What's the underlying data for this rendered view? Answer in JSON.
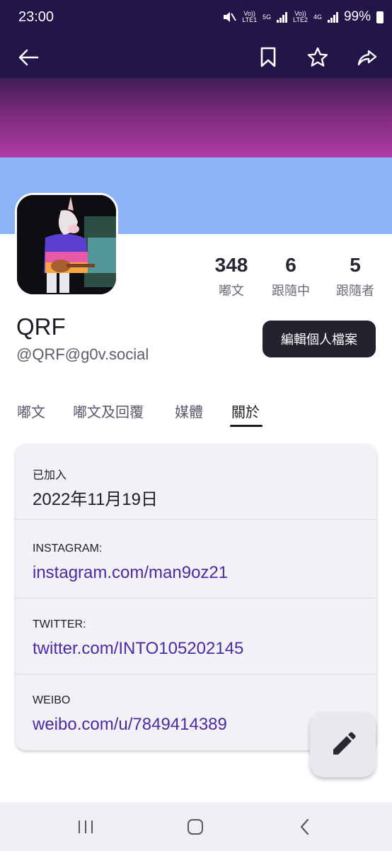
{
  "status_bar": {
    "time": "23:00",
    "sim1_label": "LTE1",
    "sim1_volte": "Vo))",
    "net1": "5G",
    "sim2_label": "LTE2",
    "sim2_volte": "Vo))",
    "net2": "4G",
    "battery": "99%",
    "icons": [
      "mute-icon",
      "signal-icon",
      "battery-icon"
    ]
  },
  "app_bar": {
    "icons": [
      "back-arrow-icon",
      "bookmark-icon",
      "star-icon",
      "share-icon"
    ]
  },
  "profile": {
    "display_name": "QRF",
    "handle": "@QRF@g0v.social",
    "edit_button": "編輯個人檔案",
    "stats": [
      {
        "value": "348",
        "label": "嘟文"
      },
      {
        "value": "6",
        "label": "跟隨中"
      },
      {
        "value": "5",
        "label": "跟隨者"
      }
    ]
  },
  "tabs": [
    {
      "label": "嘟文"
    },
    {
      "label": "嘟文及回覆"
    },
    {
      "label": "媒體"
    },
    {
      "label": "關於"
    }
  ],
  "active_tab": "關於",
  "about": {
    "fields": [
      {
        "label": "已加入",
        "value": "2022年11月19日"
      },
      {
        "label": "INSTAGRAM:",
        "value": "instagram.com/man9oz21"
      },
      {
        "label": "TWITTER:",
        "value": "twitter.com/INTO105202145"
      },
      {
        "label": "WEIBO",
        "value": "weibo.com/u/7849414389"
      }
    ]
  },
  "fab": {
    "icon": "pencil-icon"
  },
  "colors": {
    "app_bar": "#211647",
    "header_top": "#8a2f8c",
    "header_bottom": "#8cb3f8",
    "link": "#4b2ba4",
    "button": "#23222e"
  }
}
